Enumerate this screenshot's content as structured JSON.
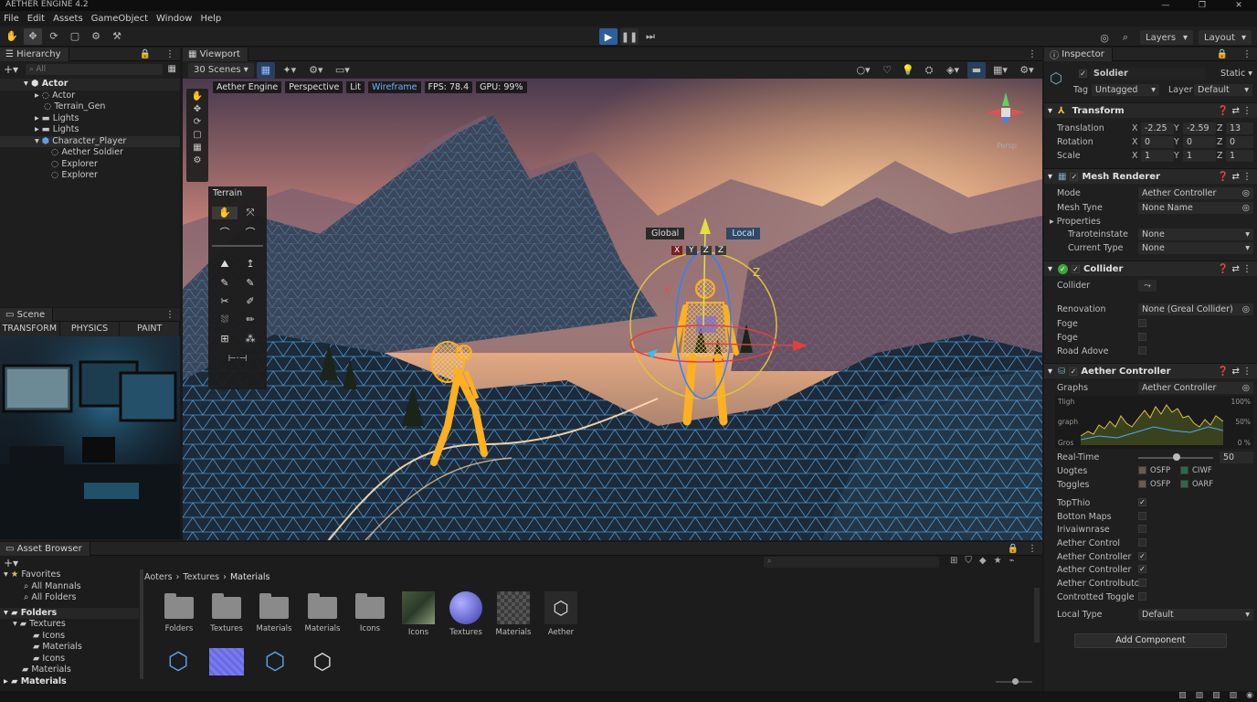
{
  "app": {
    "title": "AETHER ENGINE 4.2"
  },
  "menu": [
    "File",
    "Edit",
    "Assets",
    "GameObject",
    "Window",
    "Help"
  ],
  "toolbar": {
    "layers": "Layers",
    "layout": "Layout"
  },
  "hierarchy": {
    "title": "Hierarchy",
    "search_placeholder": "All",
    "items": [
      {
        "label": "Actor",
        "depth": 0,
        "bold": true
      },
      {
        "label": "Actor",
        "depth": 1
      },
      {
        "label": "Terrain_Gen",
        "depth": 1
      },
      {
        "label": "Lights",
        "depth": 1
      },
      {
        "label": "Lights",
        "depth": 1
      },
      {
        "label": "Character_Player",
        "depth": 1,
        "selected": true
      },
      {
        "label": "Aether Soldier",
        "depth": 2
      },
      {
        "label": "Explorer",
        "depth": 2
      },
      {
        "label": "Explorer",
        "depth": 2
      }
    ]
  },
  "scene_panel": {
    "title": "Scene",
    "tabs": [
      "TRANSFORM",
      "PHYSICS",
      "PAINT"
    ]
  },
  "viewport": {
    "title": "Viewport",
    "scenes_dropdown": "30 Scenes",
    "overlay": {
      "engine": "Aether Engine",
      "view": "Perspective",
      "lit": "Lit",
      "wireframe": "Wireframe",
      "fps": "FPS: 78.4",
      "gpu": "GPU: 99%"
    },
    "terrain_tool": {
      "title": "Terrain"
    },
    "gizmo": {
      "global": "Global",
      "local": "Local",
      "axes": [
        "X",
        "Y",
        "Z",
        "Z"
      ],
      "orient_label": "Persp",
      "handle_x": "X",
      "handle_z": "Z"
    }
  },
  "inspector": {
    "title": "Inspector",
    "object_name": "Soldier",
    "static": "Static",
    "tag_label": "Tag",
    "tag_value": "Untagged",
    "layer_label": "Layer",
    "layer_value": "Default",
    "transform": {
      "title": "Transform",
      "rows": [
        {
          "label": "Translation",
          "x": "-2.25",
          "y": "-2.59",
          "z": "13"
        },
        {
          "label": "Rotation",
          "x": "0",
          "y": "0",
          "z": "0"
        },
        {
          "label": "Scale",
          "x": "1",
          "y": "1",
          "z": "1"
        }
      ]
    },
    "mesh_renderer": {
      "title": "Mesh Renderer",
      "mode_label": "Mode",
      "mode_value": "Aether Controller",
      "mesh_label": "Mesh Tyne",
      "mesh_value": "None Name",
      "properties_label": "Properties",
      "trans_label": "Traroteinstate",
      "trans_value": "None",
      "current_label": "Current Type",
      "current_value": "None"
    },
    "collider": {
      "title": "Collider",
      "collider_label": "Collider",
      "renov_label": "Renovation",
      "renov_value": "None (Greal Collider)",
      "foge1": "Foge",
      "foge2": "Foge",
      "road": "Road Adove"
    },
    "aether_controller": {
      "title": "Aether Controller",
      "graphs_label": "Graphs",
      "graphs_value": "Aether Controller",
      "graph_labels": {
        "high": "Tligh",
        "mid": "graph",
        "low": "Gros",
        "p100": "100%",
        "p50": "50%",
        "p0": "0 %"
      },
      "realtime_label": "Real-Time",
      "realtime_value": "50",
      "uogtes_label": "Uogtes",
      "uogtes_a": "OSFP",
      "uogtes_b": "CIWF",
      "toggles_label": "Toggles",
      "toggles_a": "OSFP",
      "toggles_b": "OARF",
      "flags": [
        {
          "label": "TopThio",
          "checked": true
        },
        {
          "label": "Botton Maps",
          "checked": false
        },
        {
          "label": "Irivaiwnrase",
          "checked": false
        },
        {
          "label": "Aether Control",
          "checked": false
        },
        {
          "label": "Aether Controller",
          "checked": true
        },
        {
          "label": "Aether Controller",
          "checked": true
        },
        {
          "label": "Aether Controlbutor",
          "checked": false
        },
        {
          "label": "Controtted Toggle",
          "checked": false
        }
      ],
      "local_type_label": "Local Type",
      "local_type_value": "Default"
    },
    "add_component": "Add Component"
  },
  "assets": {
    "title": "Asset Browser",
    "favorites": "Favorites",
    "fav_items": [
      "All Mannals",
      "All Folders"
    ],
    "folders": "Folders",
    "tree": [
      {
        "label": "Textures",
        "depth": 1
      },
      {
        "label": "Icons",
        "depth": 2
      },
      {
        "label": "Materials",
        "depth": 2
      },
      {
        "label": "Icons",
        "depth": 2
      },
      {
        "label": "Materials",
        "depth": 1
      },
      {
        "label": "Materials",
        "depth": 0
      }
    ],
    "breadcrumb": [
      "Aoters",
      "Textures",
      "Materials"
    ],
    "grid": [
      {
        "label": "Folders",
        "kind": "folder"
      },
      {
        "label": "Textures",
        "kind": "folder"
      },
      {
        "label": "Materials",
        "kind": "folder"
      },
      {
        "label": "Materials",
        "kind": "folder"
      },
      {
        "label": "Icons",
        "kind": "folder"
      },
      {
        "label": "Icons",
        "kind": "photo"
      },
      {
        "label": "Textures",
        "kind": "sphere"
      },
      {
        "label": "Materials",
        "kind": "checker"
      },
      {
        "label": "Aether",
        "kind": "logo"
      }
    ]
  },
  "colors": {
    "accent": "#2f5f9a",
    "wire": "#4aa8ff",
    "hologram": "#ffb020"
  }
}
